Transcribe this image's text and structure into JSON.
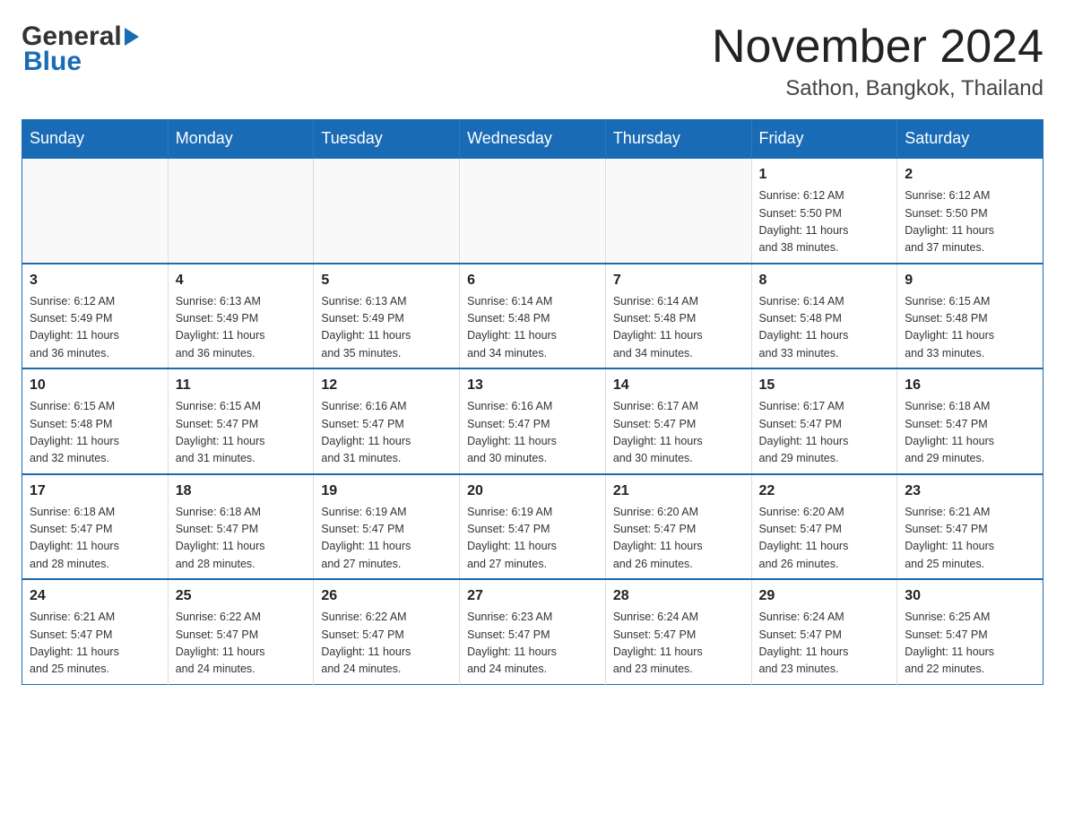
{
  "header": {
    "logo_general": "General",
    "logo_blue": "Blue",
    "title": "November 2024",
    "subtitle": "Sathon, Bangkok, Thailand"
  },
  "days_of_week": [
    "Sunday",
    "Monday",
    "Tuesday",
    "Wednesday",
    "Thursday",
    "Friday",
    "Saturday"
  ],
  "weeks": [
    [
      {
        "day": "",
        "info": ""
      },
      {
        "day": "",
        "info": ""
      },
      {
        "day": "",
        "info": ""
      },
      {
        "day": "",
        "info": ""
      },
      {
        "day": "",
        "info": ""
      },
      {
        "day": "1",
        "info": "Sunrise: 6:12 AM\nSunset: 5:50 PM\nDaylight: 11 hours\nand 38 minutes."
      },
      {
        "day": "2",
        "info": "Sunrise: 6:12 AM\nSunset: 5:50 PM\nDaylight: 11 hours\nand 37 minutes."
      }
    ],
    [
      {
        "day": "3",
        "info": "Sunrise: 6:12 AM\nSunset: 5:49 PM\nDaylight: 11 hours\nand 36 minutes."
      },
      {
        "day": "4",
        "info": "Sunrise: 6:13 AM\nSunset: 5:49 PM\nDaylight: 11 hours\nand 36 minutes."
      },
      {
        "day": "5",
        "info": "Sunrise: 6:13 AM\nSunset: 5:49 PM\nDaylight: 11 hours\nand 35 minutes."
      },
      {
        "day": "6",
        "info": "Sunrise: 6:14 AM\nSunset: 5:48 PM\nDaylight: 11 hours\nand 34 minutes."
      },
      {
        "day": "7",
        "info": "Sunrise: 6:14 AM\nSunset: 5:48 PM\nDaylight: 11 hours\nand 34 minutes."
      },
      {
        "day": "8",
        "info": "Sunrise: 6:14 AM\nSunset: 5:48 PM\nDaylight: 11 hours\nand 33 minutes."
      },
      {
        "day": "9",
        "info": "Sunrise: 6:15 AM\nSunset: 5:48 PM\nDaylight: 11 hours\nand 33 minutes."
      }
    ],
    [
      {
        "day": "10",
        "info": "Sunrise: 6:15 AM\nSunset: 5:48 PM\nDaylight: 11 hours\nand 32 minutes."
      },
      {
        "day": "11",
        "info": "Sunrise: 6:15 AM\nSunset: 5:47 PM\nDaylight: 11 hours\nand 31 minutes."
      },
      {
        "day": "12",
        "info": "Sunrise: 6:16 AM\nSunset: 5:47 PM\nDaylight: 11 hours\nand 31 minutes."
      },
      {
        "day": "13",
        "info": "Sunrise: 6:16 AM\nSunset: 5:47 PM\nDaylight: 11 hours\nand 30 minutes."
      },
      {
        "day": "14",
        "info": "Sunrise: 6:17 AM\nSunset: 5:47 PM\nDaylight: 11 hours\nand 30 minutes."
      },
      {
        "day": "15",
        "info": "Sunrise: 6:17 AM\nSunset: 5:47 PM\nDaylight: 11 hours\nand 29 minutes."
      },
      {
        "day": "16",
        "info": "Sunrise: 6:18 AM\nSunset: 5:47 PM\nDaylight: 11 hours\nand 29 minutes."
      }
    ],
    [
      {
        "day": "17",
        "info": "Sunrise: 6:18 AM\nSunset: 5:47 PM\nDaylight: 11 hours\nand 28 minutes."
      },
      {
        "day": "18",
        "info": "Sunrise: 6:18 AM\nSunset: 5:47 PM\nDaylight: 11 hours\nand 28 minutes."
      },
      {
        "day": "19",
        "info": "Sunrise: 6:19 AM\nSunset: 5:47 PM\nDaylight: 11 hours\nand 27 minutes."
      },
      {
        "day": "20",
        "info": "Sunrise: 6:19 AM\nSunset: 5:47 PM\nDaylight: 11 hours\nand 27 minutes."
      },
      {
        "day": "21",
        "info": "Sunrise: 6:20 AM\nSunset: 5:47 PM\nDaylight: 11 hours\nand 26 minutes."
      },
      {
        "day": "22",
        "info": "Sunrise: 6:20 AM\nSunset: 5:47 PM\nDaylight: 11 hours\nand 26 minutes."
      },
      {
        "day": "23",
        "info": "Sunrise: 6:21 AM\nSunset: 5:47 PM\nDaylight: 11 hours\nand 25 minutes."
      }
    ],
    [
      {
        "day": "24",
        "info": "Sunrise: 6:21 AM\nSunset: 5:47 PM\nDaylight: 11 hours\nand 25 minutes."
      },
      {
        "day": "25",
        "info": "Sunrise: 6:22 AM\nSunset: 5:47 PM\nDaylight: 11 hours\nand 24 minutes."
      },
      {
        "day": "26",
        "info": "Sunrise: 6:22 AM\nSunset: 5:47 PM\nDaylight: 11 hours\nand 24 minutes."
      },
      {
        "day": "27",
        "info": "Sunrise: 6:23 AM\nSunset: 5:47 PM\nDaylight: 11 hours\nand 24 minutes."
      },
      {
        "day": "28",
        "info": "Sunrise: 6:24 AM\nSunset: 5:47 PM\nDaylight: 11 hours\nand 23 minutes."
      },
      {
        "day": "29",
        "info": "Sunrise: 6:24 AM\nSunset: 5:47 PM\nDaylight: 11 hours\nand 23 minutes."
      },
      {
        "day": "30",
        "info": "Sunrise: 6:25 AM\nSunset: 5:47 PM\nDaylight: 11 hours\nand 22 minutes."
      }
    ]
  ]
}
